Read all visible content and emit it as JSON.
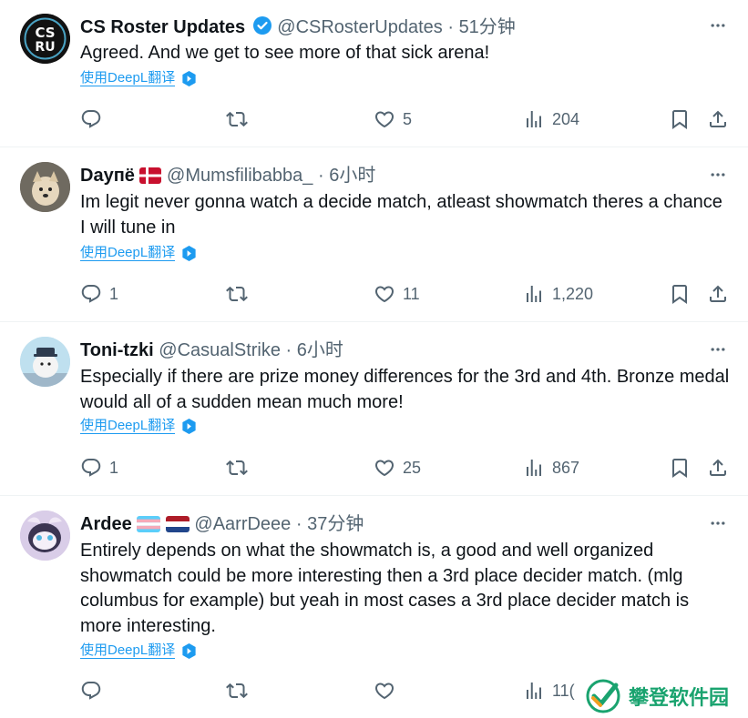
{
  "translate_label": "使用DeepL翻译",
  "tweets": [
    {
      "name": "CS Roster Updates",
      "verified": true,
      "handle": "@CSRosterUpdates",
      "sep": "·",
      "time": "51分钟",
      "text": "Agreed. And we get to see more of that sick arena!",
      "replies": "",
      "retweets": "",
      "likes": "5",
      "views": "204",
      "avatar": "cs-ru-logo"
    },
    {
      "name": "Dayпё",
      "flags": [
        "denmark"
      ],
      "handle": "@Mumsfilibabba_",
      "sep": "·",
      "time": "6小时",
      "text": "Im legit never gonna watch a decide match, atleast showmatch theres a chance I will tune in",
      "replies": "1",
      "retweets": "",
      "likes": "11",
      "views": "1,220",
      "avatar": "dog-photo"
    },
    {
      "name": "Toni-tzki",
      "handle": "@CasualStrike",
      "sep": "·",
      "time": "6小时",
      "text": "Especially if there are prize money differences for the 3rd and 4th. Bronze medal would all of a sudden mean much more!",
      "replies": "1",
      "retweets": "",
      "likes": "25",
      "views": "867",
      "avatar": "moomin-character"
    },
    {
      "name": "Ardee",
      "flags": [
        "transgender",
        "netherlands"
      ],
      "handle": "@AarrDeee",
      "sep": "·",
      "time": "37分钟",
      "text": "Entirely depends on what the showmatch is, a good and well organized showmatch could be more interesting then a 3rd place decider match. (mlg columbus for example) but yeah in most cases a 3rd place decider match is more interesting.",
      "replies": "",
      "retweets": "",
      "likes": "",
      "views": "11(",
      "avatar": "anime-creature"
    }
  ],
  "watermark": {
    "text": "攀登软件园",
    "color": "#1aa36f"
  },
  "colors": {
    "link": "#1d9bf0",
    "secondary": "#536471",
    "verified": "#1d9bf0",
    "divider": "#eff3f4"
  }
}
